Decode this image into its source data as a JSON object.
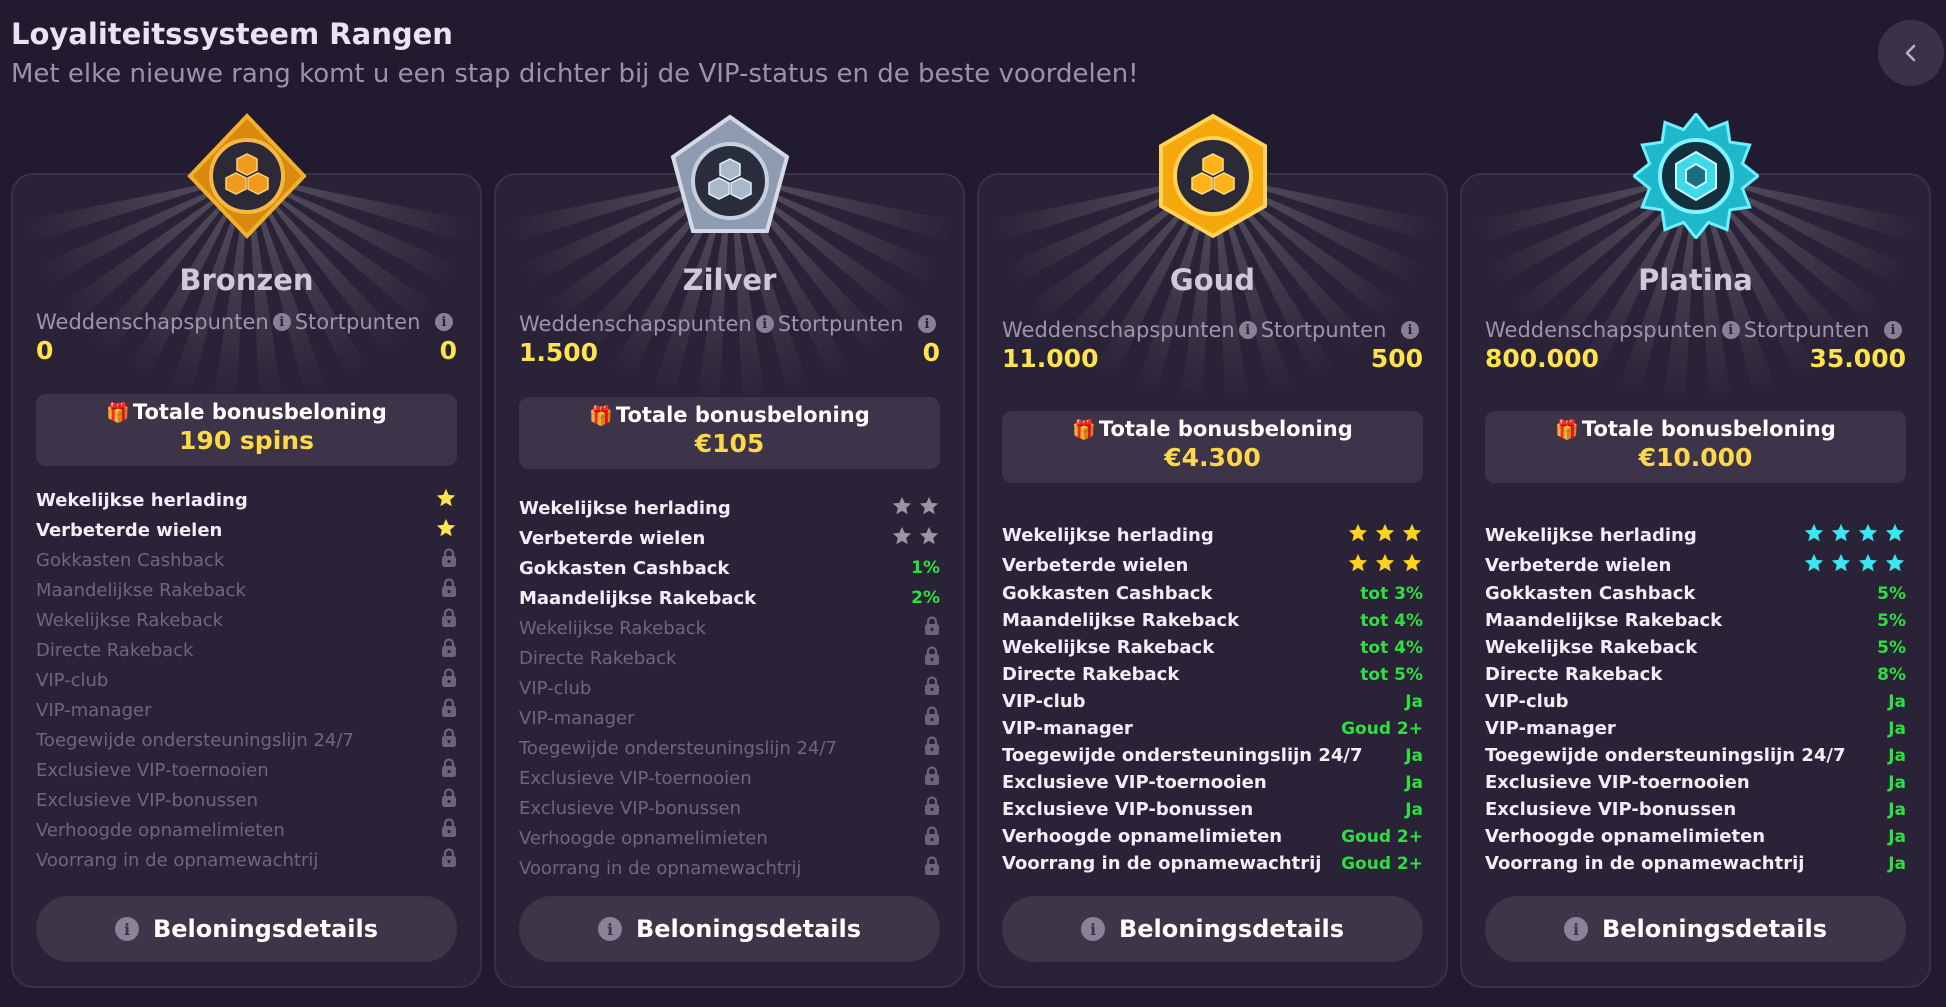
{
  "header": {
    "title": "Loyaliteitssysteem Rangen",
    "subtitle": "Met elke nieuwe rang komt u een stap dichter bij de VIP-status en de beste voordelen!"
  },
  "colors": {
    "accent_gold": "#ffd84a",
    "value_green": "#2ee03f",
    "background": "#221a2e",
    "card": "#2a2236"
  },
  "tiers": [
    {
      "name": "Bronzen",
      "badge_icon": "bronze-badge-icon",
      "betting_label": "Weddenschapspunten",
      "deposit_label": "Stortpunten",
      "betting_points": "0",
      "deposit_points": "0",
      "bonus_label": "Totale bonusbeloning",
      "bonus_value": "190 spins",
      "details_label": "Beloningsdetails",
      "features": [
        {
          "label": "Wekelijkse herlading",
          "stars": 1,
          "star_color": "#ffe34d"
        },
        {
          "label": "Verbeterde wielen",
          "stars": 1,
          "star_color": "#ffe34d"
        },
        {
          "label": "Gokkasten Cashback",
          "locked": true
        },
        {
          "label": "Maandelijkse Rakeback",
          "locked": true
        },
        {
          "label": "Wekelijkse Rakeback",
          "locked": true
        },
        {
          "label": "Directe Rakeback",
          "locked": true
        },
        {
          "label": "VIP-club",
          "locked": true
        },
        {
          "label": "VIP-manager",
          "locked": true
        },
        {
          "label": "Toegewijde ondersteuningslijn 24/7",
          "locked": true
        },
        {
          "label": "Exclusieve VIP-toernooien",
          "locked": true
        },
        {
          "label": "Exclusieve VIP-bonussen",
          "locked": true
        },
        {
          "label": "Verhoogde opnamelimieten",
          "locked": true
        },
        {
          "label": "Voorrang in de opnamewachtrij",
          "locked": true
        }
      ]
    },
    {
      "name": "Zilver",
      "badge_icon": "silver-badge-icon",
      "betting_label": "Weddenschapspunten",
      "deposit_label": "Stortpunten",
      "betting_points": "1.500",
      "deposit_points": "0",
      "bonus_label": "Totale bonusbeloning",
      "bonus_value": "€105",
      "details_label": "Beloningsdetails",
      "features": [
        {
          "label": "Wekelijkse herlading",
          "stars": 2,
          "star_color": "#9a94a3"
        },
        {
          "label": "Verbeterde wielen",
          "stars": 2,
          "star_color": "#9a94a3"
        },
        {
          "label": "Gokkasten Cashback",
          "value": "1%"
        },
        {
          "label": "Maandelijkse Rakeback",
          "value": "2%"
        },
        {
          "label": "Wekelijkse Rakeback",
          "locked": true
        },
        {
          "label": "Directe Rakeback",
          "locked": true
        },
        {
          "label": "VIP-club",
          "locked": true
        },
        {
          "label": "VIP-manager",
          "locked": true
        },
        {
          "label": "Toegewijde ondersteuningslijn 24/7",
          "locked": true
        },
        {
          "label": "Exclusieve VIP-toernooien",
          "locked": true
        },
        {
          "label": "Exclusieve VIP-bonussen",
          "locked": true
        },
        {
          "label": "Verhoogde opnamelimieten",
          "locked": true
        },
        {
          "label": "Voorrang in de opnamewachtrij",
          "locked": true
        }
      ]
    },
    {
      "name": "Goud",
      "badge_icon": "gold-badge-icon",
      "betting_label": "Weddenschapspunten",
      "deposit_label": "Stortpunten",
      "betting_points": "11.000",
      "deposit_points": "500",
      "bonus_label": "Totale bonusbeloning",
      "bonus_value": "€4.300",
      "details_label": "Beloningsdetails",
      "features": [
        {
          "label": "Wekelijkse herlading",
          "stars": 3,
          "star_color": "#ffd21f"
        },
        {
          "label": "Verbeterde wielen",
          "stars": 3,
          "star_color": "#ffd21f"
        },
        {
          "label": "Gokkasten Cashback",
          "value": "tot 3%"
        },
        {
          "label": "Maandelijkse Rakeback",
          "value": "tot 4%"
        },
        {
          "label": "Wekelijkse Rakeback",
          "value": "tot 4%"
        },
        {
          "label": "Directe Rakeback",
          "value": "tot 5%"
        },
        {
          "label": "VIP-club",
          "value": "Ja"
        },
        {
          "label": "VIP-manager",
          "value": "Goud 2+"
        },
        {
          "label": "Toegewijde ondersteuningslijn 24/7",
          "value": "Ja"
        },
        {
          "label": "Exclusieve VIP-toernooien",
          "value": "Ja"
        },
        {
          "label": "Exclusieve VIP-bonussen",
          "value": "Ja"
        },
        {
          "label": "Verhoogde opnamelimieten",
          "value": "Goud 2+"
        },
        {
          "label": "Voorrang in de opnamewachtrij",
          "value": "Goud 2+"
        }
      ]
    },
    {
      "name": "Platina",
      "badge_icon": "platinum-badge-icon",
      "betting_label": "Weddenschapspunten",
      "deposit_label": "Stortpunten",
      "betting_points": "800.000",
      "deposit_points": "35.000",
      "bonus_label": "Totale bonusbeloning",
      "bonus_value": "€10.000",
      "details_label": "Beloningsdetails",
      "features": [
        {
          "label": "Wekelijkse herlading",
          "stars": 4,
          "star_color": "#39e6f2"
        },
        {
          "label": "Verbeterde wielen",
          "stars": 4,
          "star_color": "#39e6f2"
        },
        {
          "label": "Gokkasten Cashback",
          "value": "5%"
        },
        {
          "label": "Maandelijkse Rakeback",
          "value": "5%"
        },
        {
          "label": "Wekelijkse Rakeback",
          "value": "5%"
        },
        {
          "label": "Directe Rakeback",
          "value": "8%"
        },
        {
          "label": "VIP-club",
          "value": "Ja"
        },
        {
          "label": "VIP-manager",
          "value": "Ja"
        },
        {
          "label": "Toegewijde ondersteuningslijn 24/7",
          "value": "Ja"
        },
        {
          "label": "Exclusieve VIP-toernooien",
          "value": "Ja"
        },
        {
          "label": "Exclusieve VIP-bonussen",
          "value": "Ja"
        },
        {
          "label": "Verhoogde opnamelimieten",
          "value": "Ja"
        },
        {
          "label": "Voorrang in de opnamewachtrij",
          "value": "Ja"
        }
      ]
    }
  ]
}
